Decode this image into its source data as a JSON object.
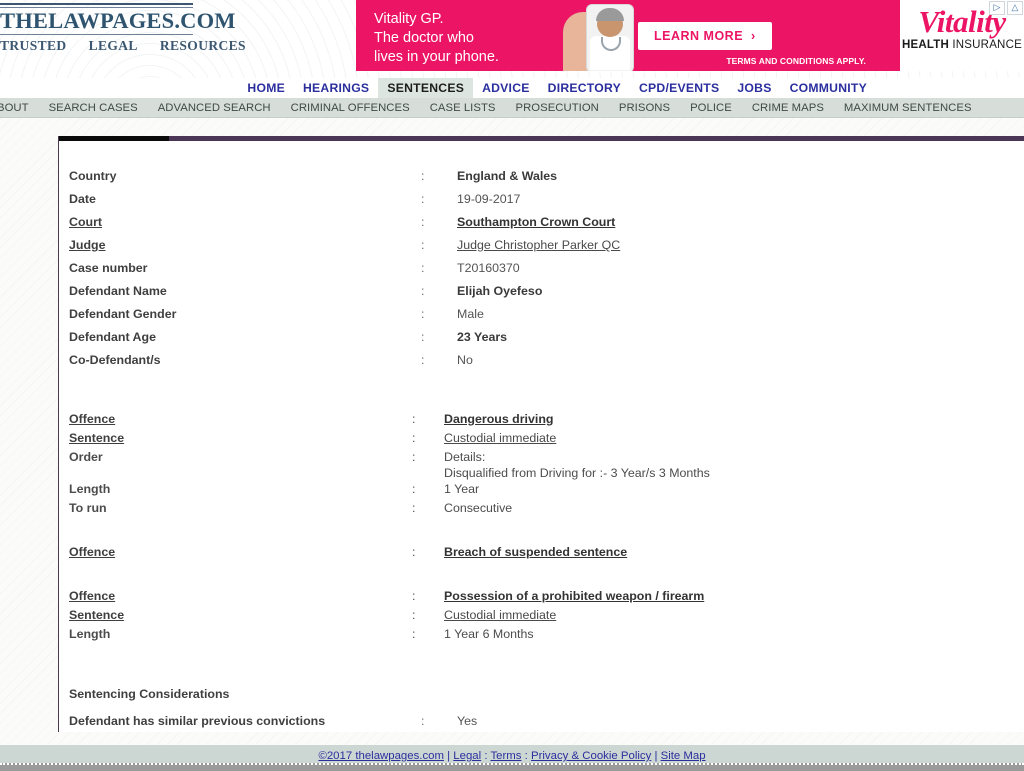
{
  "site": {
    "logo_title": "THELAWPAGES.COM",
    "logo_tagline": [
      "TRUSTED",
      "LEGAL",
      "RESOURCES"
    ]
  },
  "ad": {
    "line1": "Vitality GP.",
    "line2": "The doctor who",
    "line3": "lives in your phone.",
    "cta_label": "LEARN MORE",
    "cta_arrow": "›",
    "terms": "TERMS AND CONDITIONS APPLY.",
    "brand": "Vitality",
    "brand_sub_bold": "HEALTH",
    "brand_sub_light": " INSURANCE",
    "bg_color": "#ec1464",
    "adchoices_1": "▷",
    "adchoices_2": "△"
  },
  "main_nav": {
    "items": [
      {
        "label": "HOME",
        "active": false
      },
      {
        "label": "HEARINGS",
        "active": false
      },
      {
        "label": "SENTENCES",
        "active": true
      },
      {
        "label": "ADVICE",
        "active": false
      },
      {
        "label": "DIRECTORY",
        "active": false
      },
      {
        "label": "CPD/EVENTS",
        "active": false
      },
      {
        "label": "JOBS",
        "active": false
      },
      {
        "label": "COMMUNITY",
        "active": false
      }
    ],
    "active_color": "#1d1d1d",
    "link_color": "#2b2f9e"
  },
  "sub_nav": {
    "items": [
      {
        "label": "BOUT"
      },
      {
        "label": "SEARCH CASES"
      },
      {
        "label": "ADVANCED SEARCH"
      },
      {
        "label": "CRIMINAL OFFENCES"
      },
      {
        "label": "CASE LISTS"
      },
      {
        "label": "PROSECUTION"
      },
      {
        "label": "PRISONS"
      },
      {
        "label": "POLICE"
      },
      {
        "label": "CRIME MAPS"
      },
      {
        "label": "MAXIMUM SENTENCES"
      }
    ],
    "bg_color": "#d7ded9"
  },
  "case_details": {
    "colon": ":",
    "rows": [
      {
        "label": "Country",
        "label_link": false,
        "value": "England & Wales",
        "value_link": false,
        "value_bold": true
      },
      {
        "label": "Date",
        "label_link": false,
        "value": "19-09-2017",
        "value_link": false,
        "value_bold": false
      },
      {
        "label": "Court",
        "label_link": true,
        "value": "Southampton Crown Court",
        "value_link": true,
        "value_bold": true
      },
      {
        "label": "Judge",
        "label_link": true,
        "value": "Judge Christopher Parker QC",
        "value_link": true,
        "value_bold": false
      },
      {
        "label": "Case number",
        "label_link": false,
        "value": "T20160370",
        "value_link": false,
        "value_bold": false
      },
      {
        "label": "Defendant Name",
        "label_link": false,
        "value": "Elijah Oyefeso",
        "value_link": false,
        "value_bold": true
      },
      {
        "label": "Defendant Gender",
        "label_link": false,
        "value": "Male",
        "value_link": false,
        "value_bold": false
      },
      {
        "label": "Defendant Age",
        "label_link": false,
        "value": "23 Years",
        "value_link": false,
        "value_bold": true
      },
      {
        "label": "Co-Defendant/s",
        "label_link": false,
        "value": "No",
        "value_link": false,
        "value_bold": false
      }
    ]
  },
  "offences": [
    {
      "rows": [
        {
          "label": "Offence",
          "label_link": true,
          "value": "Dangerous driving",
          "value_link": true,
          "value_bold": true,
          "multiline": false
        },
        {
          "label": "Sentence",
          "label_link": true,
          "value": "Custodial immediate",
          "value_link": true,
          "value_bold": false,
          "multiline": false
        },
        {
          "label": "Order",
          "label_link": false,
          "value": "Details:\nDisqualified from Driving for :- 3 Year/s 3 Months",
          "value_link": false,
          "value_bold": false,
          "multiline": true
        },
        {
          "label": "Length",
          "label_link": false,
          "value": "1 Year",
          "value_link": false,
          "value_bold": false,
          "multiline": false
        },
        {
          "label": "To run",
          "label_link": false,
          "value": "Consecutive",
          "value_link": false,
          "value_bold": false,
          "multiline": false
        }
      ]
    },
    {
      "rows": [
        {
          "label": "Offence",
          "label_link": true,
          "value": "Breach of suspended sentence",
          "value_link": true,
          "value_bold": true,
          "multiline": false
        }
      ]
    },
    {
      "rows": [
        {
          "label": "Offence",
          "label_link": true,
          "value": "Possession of a prohibited weapon / firearm",
          "value_link": true,
          "value_bold": true,
          "multiline": false
        },
        {
          "label": "Sentence",
          "label_link": true,
          "value": "Custodial immediate",
          "value_link": true,
          "value_bold": false,
          "multiline": false
        },
        {
          "label": "Length",
          "label_link": false,
          "value": "1 Year 6 Months",
          "value_link": false,
          "value_bold": false,
          "multiline": false
        }
      ]
    }
  ],
  "considerations": {
    "title": "Sentencing Considerations",
    "rows": [
      {
        "label": "Defendant has similar previous convictions",
        "value": "Yes"
      }
    ]
  },
  "footer": {
    "copyright": "©2017 thelawpages.com",
    "sep1": "|",
    "legal": "Legal",
    "colon1": ":",
    "terms": "Terms",
    "colon2": ":",
    "privacy": "Privacy & Cookie Policy",
    "sep2": "|",
    "sitemap": "Site Map"
  }
}
